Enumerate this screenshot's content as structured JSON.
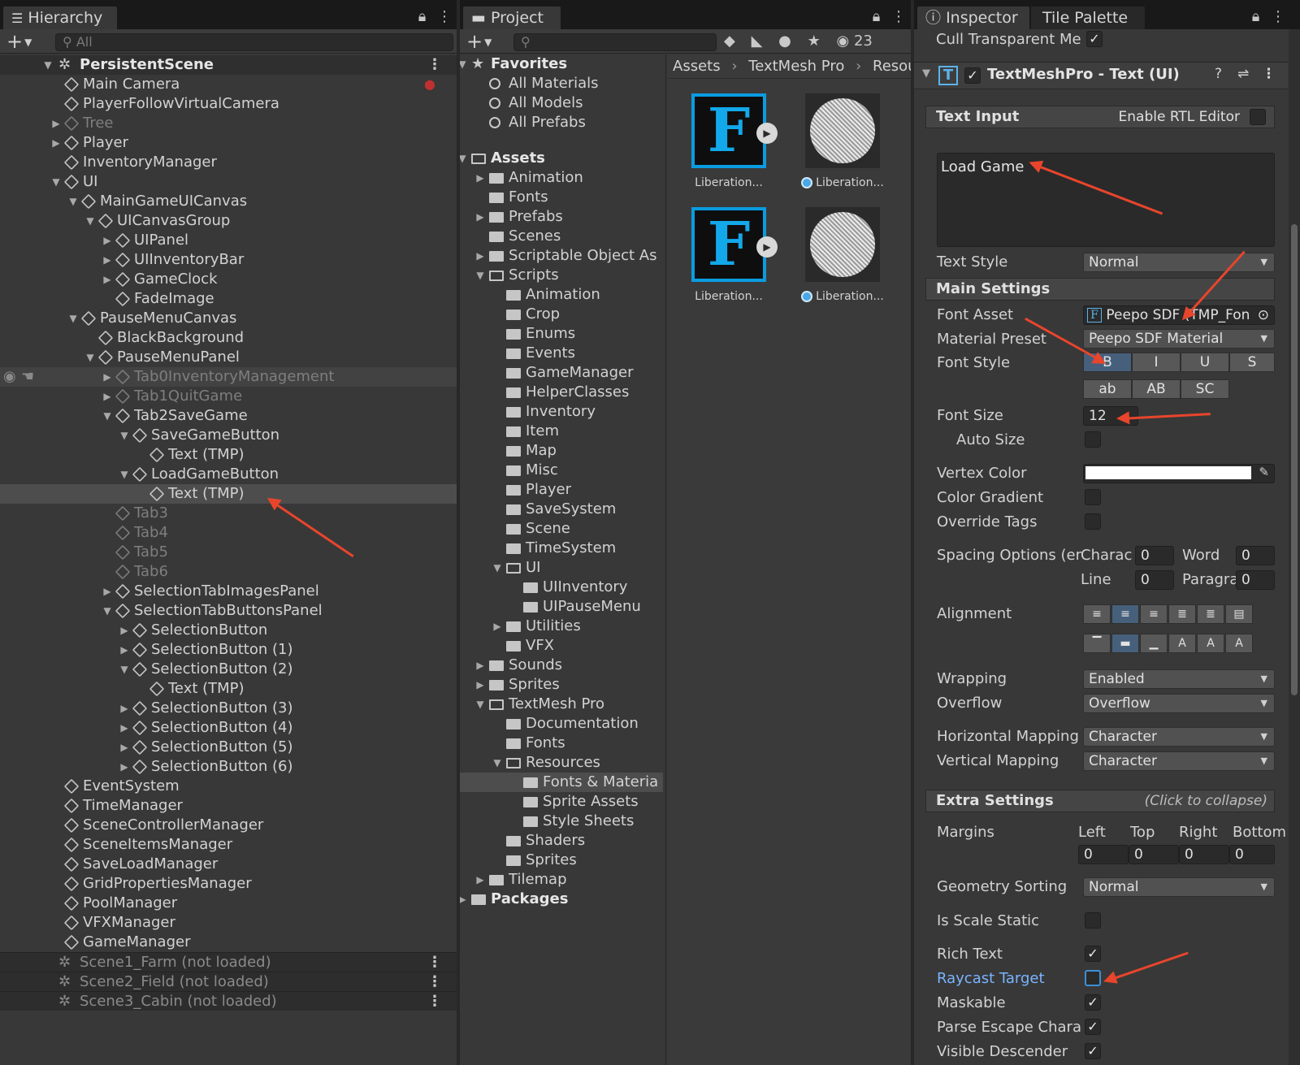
{
  "hierarchy": {
    "tab_label": "Hierarchy",
    "search_placeholder": "All",
    "scene": "PersistentScene",
    "rows": [
      {
        "label": "Main Camera"
      },
      {
        "label": "PlayerFollowVirtualCamera"
      },
      {
        "label": "Tree"
      },
      {
        "label": "Player"
      },
      {
        "label": "InventoryManager"
      },
      {
        "label": "UI"
      },
      {
        "label": "MainGameUICanvas"
      },
      {
        "label": "UICanvasGroup"
      },
      {
        "label": "UIPanel"
      },
      {
        "label": "UIInventoryBar"
      },
      {
        "label": "GameClock"
      },
      {
        "label": "FadeImage"
      },
      {
        "label": "PauseMenuCanvas"
      },
      {
        "label": "BlackBackground"
      },
      {
        "label": "PauseMenuPanel"
      },
      {
        "label": "Tab0InventoryManagement"
      },
      {
        "label": "Tab1QuitGame"
      },
      {
        "label": "Tab2SaveGame"
      },
      {
        "label": "SaveGameButton"
      },
      {
        "label": "Text (TMP)"
      },
      {
        "label": "LoadGameButton"
      },
      {
        "label": "Text (TMP)"
      },
      {
        "label": "Tab3"
      },
      {
        "label": "Tab4"
      },
      {
        "label": "Tab5"
      },
      {
        "label": "Tab6"
      },
      {
        "label": "SelectionTabImagesPanel"
      },
      {
        "label": "SelectionTabButtonsPanel"
      },
      {
        "label": "SelectionButton"
      },
      {
        "label": "SelectionButton (1)"
      },
      {
        "label": "SelectionButton (2)"
      },
      {
        "label": "Text (TMP)"
      },
      {
        "label": "SelectionButton (3)"
      },
      {
        "label": "SelectionButton (4)"
      },
      {
        "label": "SelectionButton (5)"
      },
      {
        "label": "SelectionButton (6)"
      },
      {
        "label": "EventSystem"
      },
      {
        "label": "TimeManager"
      },
      {
        "label": "SceneControllerManager"
      },
      {
        "label": "SceneItemsManager"
      },
      {
        "label": "SaveLoadManager"
      },
      {
        "label": "GridPropertiesManager"
      },
      {
        "label": "PoolManager"
      },
      {
        "label": "VFXManager"
      },
      {
        "label": "GameManager"
      }
    ],
    "unloaded": [
      "Scene1_Farm (not loaded)",
      "Scene2_Field (not loaded)",
      "Scene3_Cabin (not loaded)"
    ]
  },
  "project": {
    "tab_label": "Project",
    "visible_count": "23",
    "favorites": "Favorites",
    "favorite_items": [
      "All Materials",
      "All Models",
      "All Prefabs"
    ],
    "assets_root": "Assets",
    "tree": [
      {
        "label": "Animation"
      },
      {
        "label": "Fonts"
      },
      {
        "label": "Prefabs"
      },
      {
        "label": "Scenes"
      },
      {
        "label": "Scriptable Object As"
      },
      {
        "label": "Scripts"
      },
      {
        "label": "Animation"
      },
      {
        "label": "Crop"
      },
      {
        "label": "Enums"
      },
      {
        "label": "Events"
      },
      {
        "label": "GameManager"
      },
      {
        "label": "HelperClasses"
      },
      {
        "label": "Inventory"
      },
      {
        "label": "Item"
      },
      {
        "label": "Map"
      },
      {
        "label": "Misc"
      },
      {
        "label": "Player"
      },
      {
        "label": "SaveSystem"
      },
      {
        "label": "Scene"
      },
      {
        "label": "TimeSystem"
      },
      {
        "label": "UI"
      },
      {
        "label": "UIInventory"
      },
      {
        "label": "UIPauseMenu"
      },
      {
        "label": "Utilities"
      },
      {
        "label": "VFX"
      },
      {
        "label": "Sounds"
      },
      {
        "label": "Sprites"
      },
      {
        "label": "TextMesh Pro"
      },
      {
        "label": "Documentation"
      },
      {
        "label": "Fonts"
      },
      {
        "label": "Resources"
      },
      {
        "label": "Fonts & Materia"
      },
      {
        "label": "Sprite Assets"
      },
      {
        "label": "Style Sheets"
      },
      {
        "label": "Shaders"
      },
      {
        "label": "Sprites"
      },
      {
        "label": "Tilemap"
      }
    ],
    "packages": "Packages",
    "breadcrumb": [
      "Assets",
      "TextMesh Pro",
      "Resourc"
    ],
    "assets": [
      {
        "label": "Liberation..."
      },
      {
        "label": "Liberation..."
      },
      {
        "label": "Liberation..."
      },
      {
        "label": "Liberation..."
      }
    ]
  },
  "inspector": {
    "tab_label": "Inspector",
    "tab2_label": "Tile Palette",
    "cull_label": "Cull Transparent Me",
    "component_title": "TextMeshPro - Text (UI)",
    "text_input_header": "Text Input",
    "rtl_label": "Enable RTL Editor",
    "text_value": "Load Game",
    "text_style_label": "Text Style",
    "text_style_value": "Normal",
    "main_settings_header": "Main Settings",
    "font_asset_label": "Font Asset",
    "font_asset_value": "Peepo SDF (TMP_Fon",
    "material_preset_label": "Material Preset",
    "material_preset_value": "Peepo SDF Material",
    "font_style_label": "Font Style",
    "font_style_buttons": [
      "B",
      "I",
      "U",
      "S",
      "ab",
      "AB",
      "SC"
    ],
    "font_size_label": "Font Size",
    "font_size_value": "12",
    "auto_size_label": "Auto Size",
    "vertex_color_label": "Vertex Color",
    "color_gradient_label": "Color Gradient",
    "override_tags_label": "Override Tags",
    "spacing_label": "Spacing Options (em",
    "char_label": "Charac",
    "char_value": "0",
    "word_label": "Word",
    "word_value": "0",
    "line_label": "Line",
    "line_value": "0",
    "para_label": "Paragra",
    "para_value": "0",
    "alignment_label": "Alignment",
    "wrapping_label": "Wrapping",
    "wrapping_value": "Enabled",
    "overflow_label": "Overflow",
    "overflow_value": "Overflow",
    "hmap_label": "Horizontal Mapping",
    "hmap_value": "Character",
    "vmap_label": "Vertical Mapping",
    "vmap_value": "Character",
    "extra_header": "Extra Settings",
    "collapse_hint": "(Click to collapse)",
    "margins_label": "Margins",
    "margin_cols": [
      "Left",
      "Top",
      "Right",
      "Bottom"
    ],
    "margin_values": [
      "0",
      "0",
      "0",
      "0"
    ],
    "geometry_label": "Geometry Sorting",
    "geometry_value": "Normal",
    "scale_static_label": "Is Scale Static",
    "rich_text_label": "Rich Text",
    "raycast_label": "Raycast Target",
    "maskable_label": "Maskable",
    "parse_escape_label": "Parse Escape Chara",
    "visible_desc_label": "Visible Descender"
  },
  "colors": {
    "accent": "#46607c",
    "annotation_arrow": "#e8452c",
    "link_label": "#79b4ff",
    "font_icon": "#13a8ea"
  }
}
